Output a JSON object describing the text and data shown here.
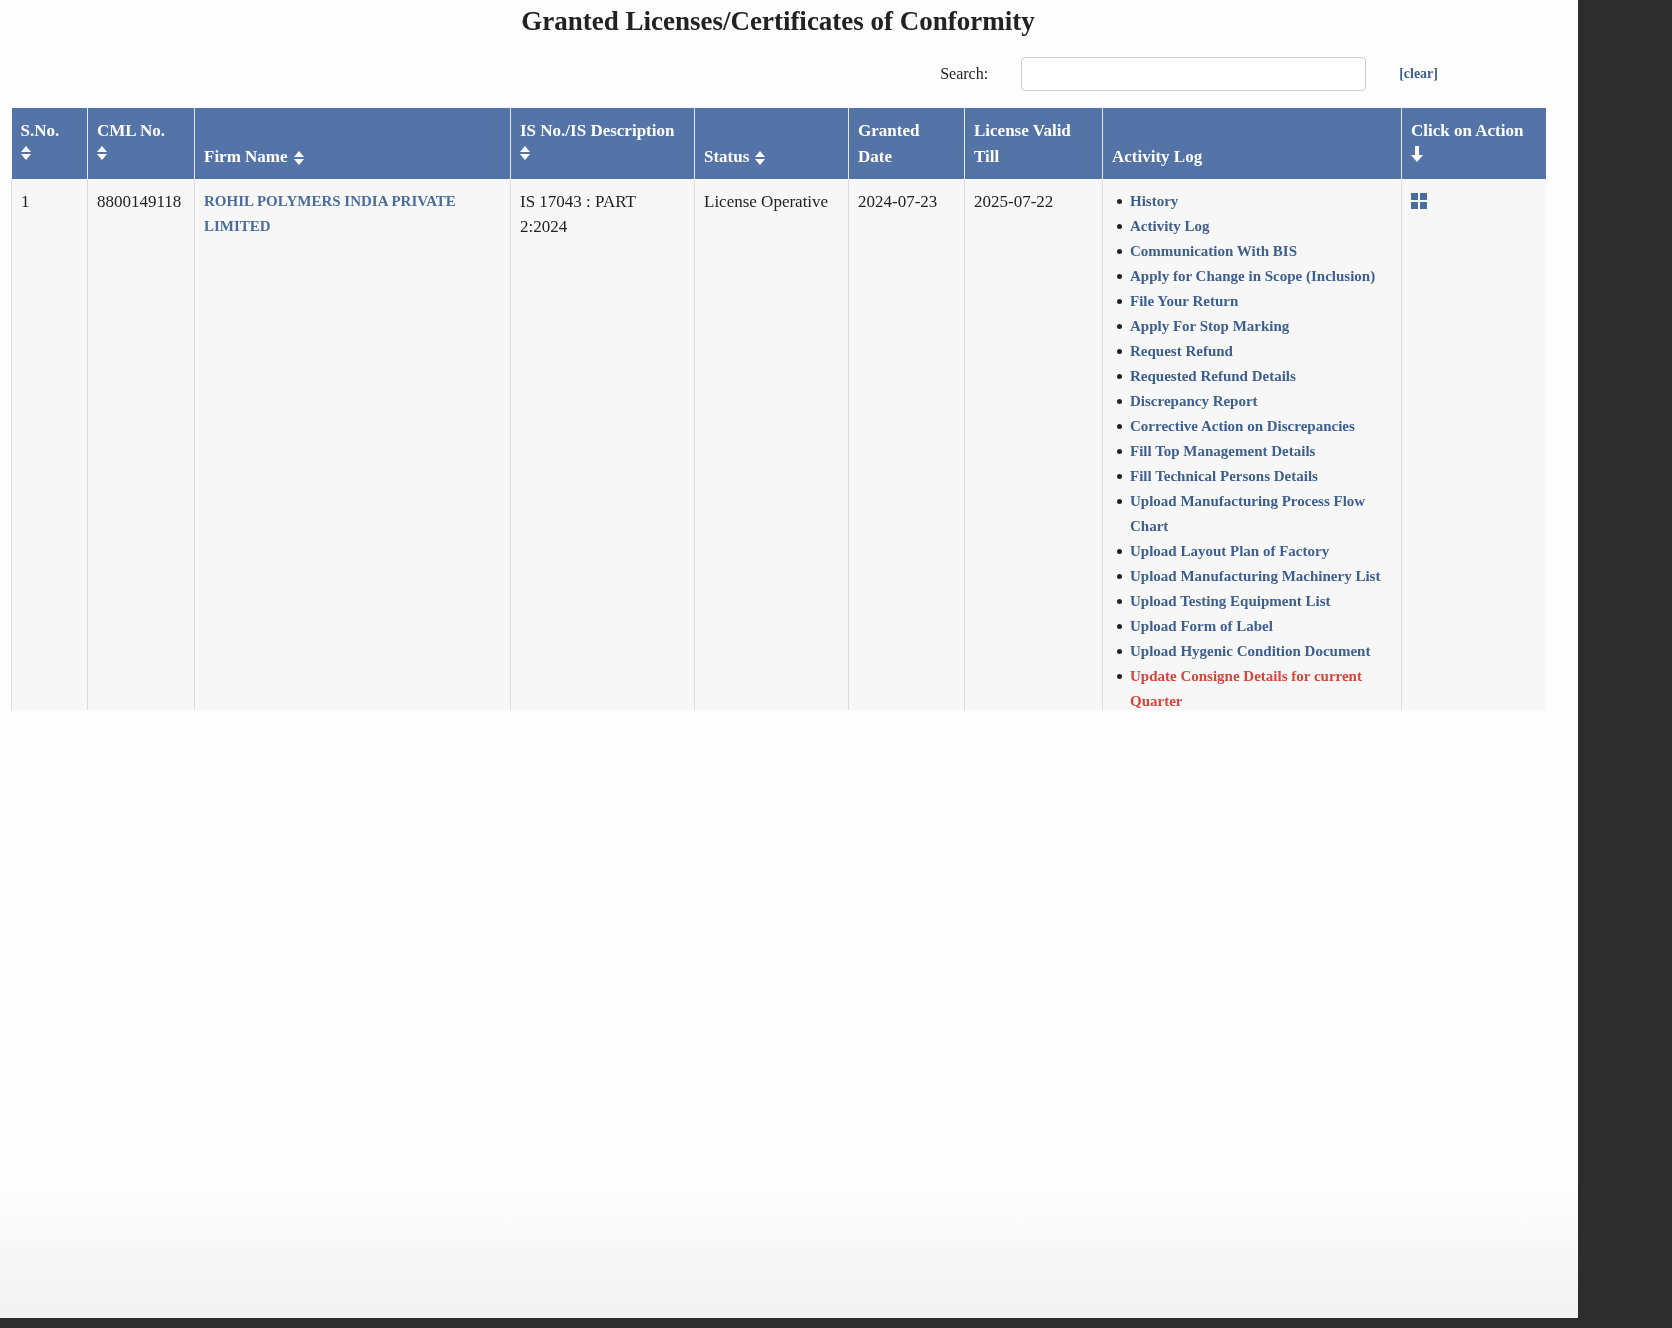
{
  "title": "Granted Licenses/Certificates of Conformity",
  "search": {
    "label": "Search:",
    "clear": "[clear]"
  },
  "table": {
    "columns": [
      {
        "label": "S.No.",
        "sortable": true,
        "sorted_descending": false
      },
      {
        "label": "CML No.",
        "sortable": true,
        "sorted_descending": false
      },
      {
        "label": "Firm Name",
        "sortable": true,
        "sorted_descending": false
      },
      {
        "label": "IS No./IS Description",
        "sortable": true,
        "sorted_descending": false
      },
      {
        "label": "Status",
        "sortable": true,
        "sorted_descending": false
      },
      {
        "label": "Granted Date",
        "sortable": false
      },
      {
        "label": "License Valid Till",
        "sortable": false
      },
      {
        "label": "Activity Log",
        "sortable": false
      },
      {
        "label": "Click on Action",
        "sortable": true,
        "sorted_descending": true
      }
    ],
    "rows": [
      {
        "sno": "1",
        "cml": "8800149118",
        "firm": "ROHIL POLYMERS INDIA PRIVATE LIMITED",
        "is": "IS 17043 : PART 2:2024",
        "status": "License Operative",
        "granted": "2024-07-23",
        "valid": "2025-07-22",
        "activity": [
          {
            "label": "History",
            "kind": "link"
          },
          {
            "label": "Activity Log",
            "kind": "link"
          },
          {
            "label": "Communication With BIS",
            "kind": "link"
          },
          {
            "label": "Apply for Change in Scope (Inclusion)",
            "kind": "link"
          },
          {
            "label": "File Your Return",
            "kind": "link"
          },
          {
            "label": "Apply For Stop Marking",
            "kind": "link"
          },
          {
            "label": "Request Refund",
            "kind": "link"
          },
          {
            "label": "Requested Refund Details",
            "kind": "link"
          },
          {
            "label": "Discrepancy Report",
            "kind": "link"
          },
          {
            "label": "Corrective Action on Discrepancies",
            "kind": "link"
          },
          {
            "label": "Fill Top Management Details",
            "kind": "link"
          },
          {
            "label": "Fill Technical Persons Details",
            "kind": "link"
          },
          {
            "label": "Upload Manufacturing Process Flow Chart",
            "kind": "link"
          },
          {
            "label": "Upload Layout Plan of Factory",
            "kind": "link"
          },
          {
            "label": "Upload Manufacturing Machinery List",
            "kind": "link"
          },
          {
            "label": "Upload Testing Equipment List",
            "kind": "link"
          },
          {
            "label": "Upload Form of Label",
            "kind": "link"
          },
          {
            "label": "Upload Hygenic Condition Document",
            "kind": "link"
          },
          {
            "label": "Update Consigne Details for current Quarter",
            "kind": "alert"
          }
        ]
      }
    ]
  }
}
